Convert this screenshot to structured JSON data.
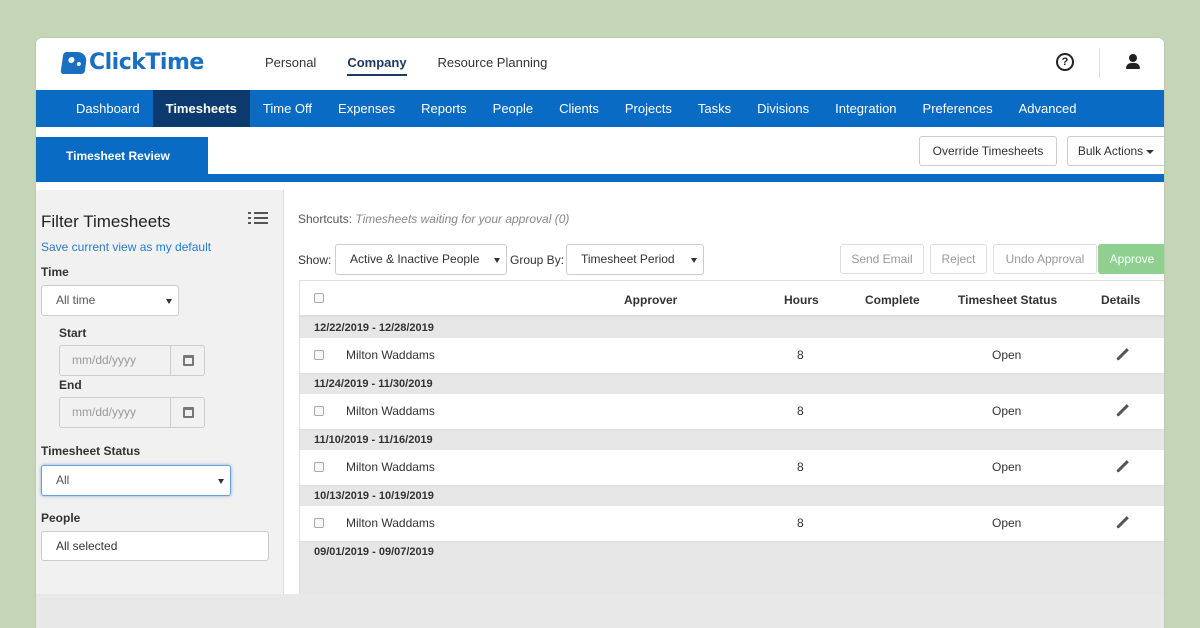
{
  "app": {
    "name": "ClickTime"
  },
  "topnav": {
    "items": [
      "Personal",
      "Company",
      "Resource Planning"
    ],
    "active": "Company"
  },
  "mainnav": {
    "items": [
      "Dashboard",
      "Timesheets",
      "Time Off",
      "Expenses",
      "Reports",
      "People",
      "Clients",
      "Projects",
      "Tasks",
      "Divisions",
      "Integration",
      "Preferences",
      "Advanced"
    ],
    "active": "Timesheets"
  },
  "subheader": {
    "tab": "Timesheet Review",
    "override_label": "Override Timesheets",
    "bulk_label": "Bulk Actions"
  },
  "sidebar": {
    "title": "Filter Timesheets",
    "save_link": "Save current view as my default",
    "time_label": "Time",
    "time_value": "All time",
    "start_label": "Start",
    "end_label": "End",
    "date_placeholder": "mm/dd/yyyy",
    "status_label": "Timesheet Status",
    "status_value": "All",
    "people_label": "People",
    "people_value": "All selected"
  },
  "content": {
    "shortcuts_label": "Shortcuts:",
    "shortcuts_link": "Timesheets waiting for your approval (0)",
    "show_label": "Show:",
    "show_value": "Active & Inactive People",
    "groupby_label": "Group By:",
    "groupby_value": "Timesheet Period",
    "actions": {
      "send_email": "Send Email",
      "reject": "Reject",
      "undo": "Undo Approval",
      "approve": "Approve"
    }
  },
  "table": {
    "columns": {
      "approver": "Approver",
      "hours": "Hours",
      "complete": "Complete",
      "status": "Timesheet Status",
      "details": "Details"
    },
    "groups": [
      {
        "period": "12/22/2019 - 12/28/2019",
        "rows": [
          {
            "name": "Milton Waddams",
            "hours": "8",
            "status": "Open"
          }
        ]
      },
      {
        "period": "11/24/2019 - 11/30/2019",
        "rows": [
          {
            "name": "Milton Waddams",
            "hours": "8",
            "status": "Open"
          }
        ]
      },
      {
        "period": "11/10/2019 - 11/16/2019",
        "rows": [
          {
            "name": "Milton Waddams",
            "hours": "8",
            "status": "Open"
          }
        ]
      },
      {
        "period": "10/13/2019 - 10/19/2019",
        "rows": [
          {
            "name": "Milton Waddams",
            "hours": "8",
            "status": "Open"
          }
        ]
      },
      {
        "period": "09/01/2019 - 09/07/2019",
        "rows": []
      }
    ]
  },
  "colors": {
    "brand": "#0a6bc4",
    "nav_active": "#0d3a6e",
    "approve": "#8fcf8f",
    "background": "#c5d6b8"
  }
}
